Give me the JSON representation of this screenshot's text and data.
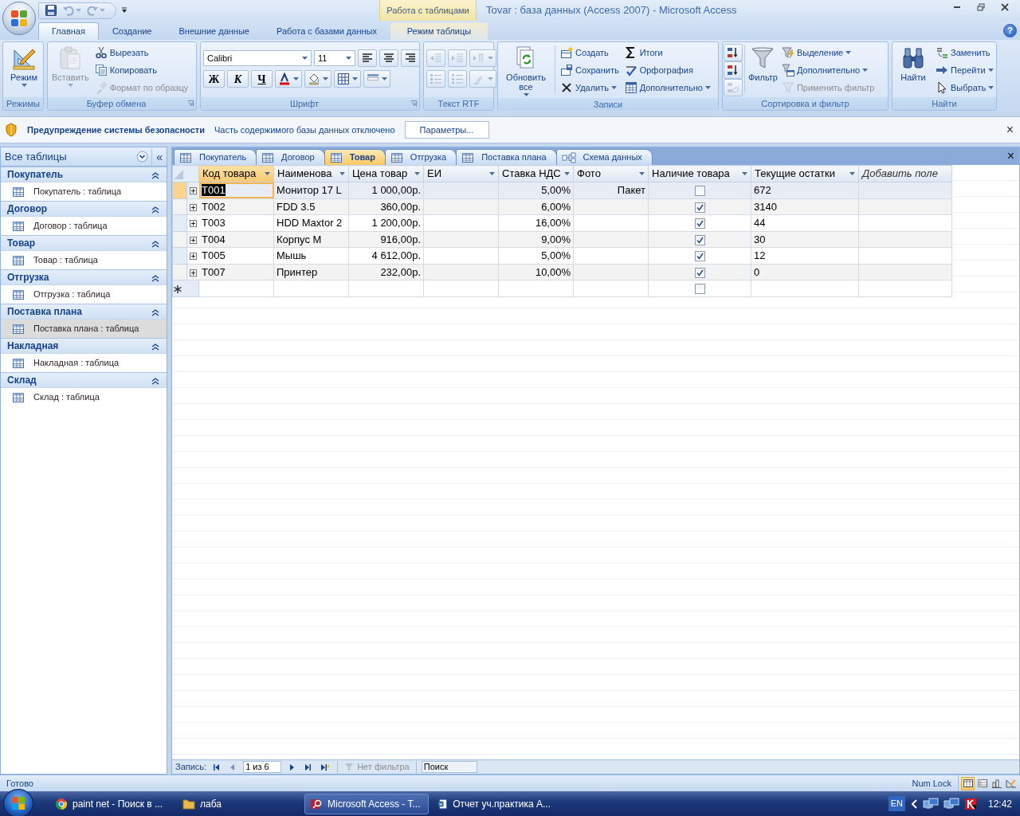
{
  "window": {
    "title": "Tovar : база данных (Access 2007) - Microsoft Access",
    "context_group": "Работа с таблицами"
  },
  "quick_access": [
    {
      "disabled": false
    },
    {
      "disabled": true
    },
    {
      "disabled": true
    }
  ],
  "ribbon": {
    "tabs": [
      {
        "label": "Главная",
        "selected": true,
        "contextual": false
      },
      {
        "label": "Создание",
        "selected": false,
        "contextual": false
      },
      {
        "label": "Внешние данные",
        "selected": false,
        "contextual": false
      },
      {
        "label": "Работа с базами данных",
        "selected": false,
        "contextual": false
      },
      {
        "label": "Режим таблицы",
        "selected": false,
        "contextual": true
      }
    ],
    "help": "?",
    "groups": [
      {
        "title": "Режимы",
        "launcher": false,
        "parts": [
          {
            "items": [
              {
                "kind": "large",
                "label": "Режим",
                "dropdown": true,
                "disabled": false
              }
            ]
          }
        ]
      },
      {
        "title": "Буфер обмена",
        "launcher": true,
        "parts": [
          {
            "items": [
              {
                "kind": "large",
                "label": "Вставить",
                "dropdown": true,
                "disabled": true
              }
            ]
          },
          {
            "items": [
              {
                "kind": "small",
                "label": "Вырезать",
                "dropdown": false,
                "disabled": false
              },
              {
                "kind": "small",
                "label": "Копировать",
                "dropdown": false,
                "disabled": false
              },
              {
                "kind": "small",
                "label": "Формат по образцу",
                "dropdown": false,
                "disabled": true
              }
            ]
          }
        ]
      },
      {
        "title": "Шрифт",
        "launcher": true,
        "parts": [
          {
            "items": [
              {
                "kind": "combo",
                "value": "Calibri"
              },
              {
                "kind": "combo",
                "value": "11"
              },
              {
                "kind": "icon",
                "dropdown": false,
                "disabled": false
              },
              {
                "kind": "icon",
                "dropdown": false,
                "disabled": false
              },
              {
                "kind": "icon",
                "dropdown": false,
                "disabled": false
              }
            ]
          },
          {
            "items": [
              {
                "kind": "text",
                "label": "Ж",
                "disabled": false
              },
              {
                "kind": "text",
                "label": "К",
                "disabled": false
              },
              {
                "kind": "text",
                "label": "Ч",
                "disabled": false
              },
              {
                "kind": "icon",
                "dropdown": true,
                "disabled": false
              },
              {
                "kind": "icon",
                "dropdown": true,
                "disabled": false
              },
              {
                "kind": "icon",
                "dropdown": true,
                "disabled": false
              },
              {
                "kind": "icon",
                "dropdown": true,
                "disabled": false
              }
            ]
          }
        ]
      },
      {
        "title": "Текст RTF",
        "launcher": false,
        "parts": [
          {
            "items": [
              {
                "kind": "icon",
                "dropdown": false,
                "disabled": true
              },
              {
                "kind": "icon",
                "dropdown": false,
                "disabled": true
              },
              {
                "kind": "icon",
                "dropdown": true,
                "disabled": true
              }
            ]
          },
          {
            "items": [
              {
                "kind": "icon",
                "dropdown": false,
                "disabled": true
              },
              {
                "kind": "icon",
                "dropdown": false,
                "disabled": true
              },
              {
                "kind": "icon",
                "dropdown": true,
                "disabled": true
              }
            ]
          }
        ]
      },
      {
        "title": "Записи",
        "launcher": false,
        "parts": [
          {
            "items": [
              {
                "kind": "large",
                "label": "Обновить все",
                "dropdown": true,
                "disabled": false
              }
            ]
          },
          {
            "divider": true,
            "items": [
              {
                "kind": "small",
                "label": "Создать",
                "dropdown": false,
                "disabled": false
              },
              {
                "kind": "small",
                "label": "Сохранить",
                "dropdown": false,
                "disabled": false
              },
              {
                "kind": "small",
                "label": "Удалить",
                "dropdown": true,
                "disabled": false
              }
            ]
          },
          {
            "items": [
              {
                "kind": "small",
                "label": "Итоги",
                "dropdown": false,
                "disabled": false
              },
              {
                "kind": "small",
                "label": "Орфография",
                "dropdown": false,
                "disabled": false
              },
              {
                "kind": "small",
                "label": "Дополнительно",
                "dropdown": true,
                "disabled": false
              }
            ]
          }
        ]
      },
      {
        "title": "Сортировка и фильтр",
        "launcher": false,
        "parts": [
          {
            "items": [
              {
                "kind": "icon",
                "dropdown": false,
                "disabled": false
              },
              {
                "kind": "icon",
                "dropdown": false,
                "disabled": false
              },
              {
                "kind": "icon",
                "dropdown": false,
                "disabled": true
              }
            ]
          },
          {
            "divider": true,
            "items": [
              {
                "kind": "large",
                "label": "Фильтр",
                "dropdown": false,
                "disabled": false
              }
            ]
          },
          {
            "items": [
              {
                "kind": "small",
                "label": "Выделение",
                "dropdown": true,
                "disabled": false
              },
              {
                "kind": "small",
                "label": "Дополнительно",
                "dropdown": true,
                "disabled": false
              },
              {
                "kind": "small",
                "label": "Применить фильтр",
                "dropdown": false,
                "disabled": true
              }
            ]
          }
        ]
      },
      {
        "title": "Найти",
        "launcher": false,
        "parts": [
          {
            "items": [
              {
                "kind": "large",
                "label": "Найти",
                "dropdown": false,
                "disabled": false
              }
            ]
          },
          {
            "items": [
              {
                "kind": "small",
                "label": "Заменить",
                "dropdown": false,
                "disabled": false
              },
              {
                "kind": "small",
                "label": "Перейти",
                "dropdown": true,
                "disabled": false
              },
              {
                "kind": "small",
                "label": "Выбрать",
                "dropdown": true,
                "disabled": false
              }
            ]
          }
        ]
      }
    ]
  },
  "security_bar": {
    "title": "Предупреждение системы безопасности",
    "message": "Часть содержимого базы данных отключено",
    "button": "Параметры...",
    "close": "×"
  },
  "nav_pane": {
    "header": "Все таблицы",
    "collapse": "«",
    "groups": [
      {
        "title": "Покупатель",
        "expanded": true,
        "items": [
          {
            "label": "Покупатель : таблица",
            "selected": false
          }
        ]
      },
      {
        "title": "Договор",
        "expanded": true,
        "items": [
          {
            "label": "Договор : таблица",
            "selected": false
          }
        ]
      },
      {
        "title": "Товар",
        "expanded": true,
        "items": [
          {
            "label": "Товар : таблица",
            "selected": false
          }
        ]
      },
      {
        "title": "Отгрузка",
        "expanded": true,
        "items": [
          {
            "label": "Отгрузка : таблица",
            "selected": false
          }
        ]
      },
      {
        "title": "Поставка плана",
        "expanded": true,
        "items": [
          {
            "label": "Поставка плана : таблица",
            "selected": true
          }
        ]
      },
      {
        "title": "Накладная",
        "expanded": true,
        "items": [
          {
            "label": "Накладная : таблица",
            "selected": false
          }
        ]
      },
      {
        "title": "Склад",
        "expanded": true,
        "items": [
          {
            "label": "Склад : таблица",
            "selected": false
          }
        ]
      }
    ]
  },
  "document_tabs": {
    "close": "×",
    "tabs": [
      {
        "label": "Покупатель",
        "kind": "table",
        "selected": false
      },
      {
        "label": "Договор",
        "kind": "table",
        "selected": false
      },
      {
        "label": "Товар",
        "kind": "table",
        "selected": true
      },
      {
        "label": "Отгрузка",
        "kind": "table",
        "selected": false
      },
      {
        "label": "Поставка плана",
        "kind": "table",
        "selected": false
      },
      {
        "label": "Схема данных",
        "kind": "diagram",
        "selected": false
      }
    ]
  },
  "table": {
    "columns": [
      {
        "label": "Код товара",
        "kind": "text",
        "dropdown": true,
        "selected": true
      },
      {
        "label": "Наименова",
        "kind": "text",
        "dropdown": true,
        "selected": false
      },
      {
        "label": "Цена товар",
        "kind": "text",
        "dropdown": true,
        "selected": false
      },
      {
        "label": "ЕИ",
        "kind": "text",
        "dropdown": true,
        "selected": false
      },
      {
        "label": "Ставка НДС",
        "kind": "text",
        "dropdown": true,
        "selected": false
      },
      {
        "label": "Фото",
        "kind": "text",
        "dropdown": true,
        "selected": false
      },
      {
        "label": "Наличие товара",
        "kind": "checkbox",
        "dropdown": true,
        "selected": false
      },
      {
        "label": "Текущие остатки",
        "kind": "text",
        "dropdown": true,
        "selected": false
      },
      {
        "label": "Добавить поле",
        "kind": "add",
        "dropdown": false,
        "selected": false
      }
    ],
    "rows": [
      {
        "code": "T001",
        "name": "Монитор 17 L",
        "price": "1 000,00р.",
        "vat": "5,00%",
        "photo": "Пакет",
        "in_stock": false,
        "stock": "672",
        "selected": true
      },
      {
        "code": "T002",
        "name": "FDD 3.5",
        "price": "360,00р.",
        "vat": "6,00%",
        "in_stock": true,
        "stock": "3140",
        "selected": false
      },
      {
        "code": "T003",
        "name": "HDD Maxtor 2",
        "price": "1 200,00р.",
        "vat": "16,00%",
        "in_stock": true,
        "stock": "44",
        "selected": false
      },
      {
        "code": "T004",
        "name": "Корпус M",
        "price": "916,00р.",
        "vat": "9,00%",
        "in_stock": true,
        "stock": "30",
        "selected": false
      },
      {
        "code": "T005",
        "name": "Мышь",
        "price": "4 612,00р.",
        "vat": "5,00%",
        "in_stock": true,
        "stock": "12",
        "selected": false
      },
      {
        "code": "T007",
        "name": "Принтер",
        "price": "232,00р.",
        "vat": "10,00%",
        "in_stock": true,
        "stock": "0",
        "selected": false
      }
    ],
    "new_row": {
      "in_stock": false
    }
  },
  "record_nav": {
    "label": "Запись:",
    "position": "1 из 6",
    "buttons": [
      {
        "disabled": false
      },
      {
        "disabled": true
      },
      {
        "disabled": false
      },
      {
        "disabled": false
      },
      {
        "disabled": false
      }
    ],
    "filter": "Нет фильтра",
    "filter_active": false,
    "search_placeholder": "Поиск"
  },
  "status_bar": {
    "text": "Готово",
    "indicator": "Num Lock",
    "views": [
      {
        "selected": true
      },
      {
        "selected": false
      },
      {
        "selected": false
      },
      {
        "selected": false
      }
    ]
  },
  "taskbar": {
    "items": [
      {
        "label": "paint net - Поиск в ...",
        "selected": false
      },
      {
        "label": "лаба",
        "selected": false
      },
      {
        "label": "Microsoft Access - T...",
        "selected": true
      },
      {
        "label": "Отчет уч.практика A...",
        "selected": false
      }
    ],
    "language": "EN",
    "time": "12:42"
  }
}
